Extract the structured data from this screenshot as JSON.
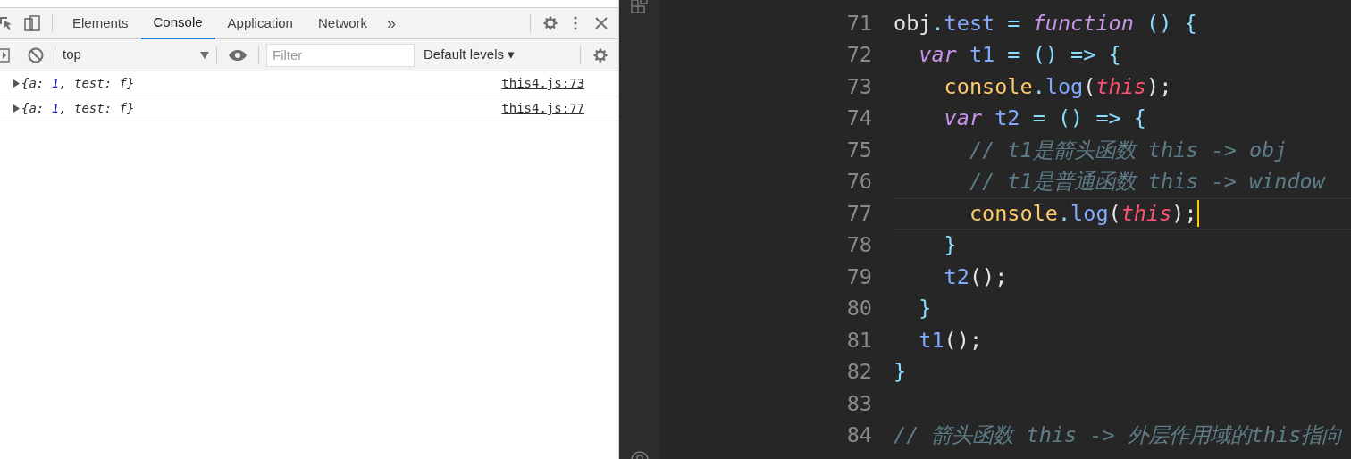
{
  "devtools": {
    "tabs": [
      {
        "label": "Elements",
        "selected": false
      },
      {
        "label": "Console",
        "selected": true
      },
      {
        "label": "Application",
        "selected": false
      },
      {
        "label": "Network",
        "selected": false
      }
    ],
    "more_tabs": "»",
    "context": "top",
    "filter": {
      "placeholder": "Filter"
    },
    "levels": "Default levels ▾",
    "messages": [
      {
        "parts": [
          {
            "text": "{a: ",
            "kind": "plain"
          },
          {
            "text": "1",
            "kind": "number"
          },
          {
            "text": ", test: ",
            "kind": "plain"
          },
          {
            "text": "f",
            "kind": "plain"
          },
          {
            "text": "}",
            "kind": "plain"
          }
        ],
        "source": "this4.js:73"
      },
      {
        "parts": [
          {
            "text": "{a: ",
            "kind": "plain"
          },
          {
            "text": "1",
            "kind": "number"
          },
          {
            "text": ", test: ",
            "kind": "plain"
          },
          {
            "text": "f",
            "kind": "plain"
          },
          {
            "text": "}",
            "kind": "plain"
          }
        ],
        "source": "this4.js:77"
      }
    ]
  },
  "editor": {
    "lines": [
      {
        "number": "71",
        "current": false,
        "tokens": [
          {
            "text": "obj",
            "kind": "plain"
          },
          {
            "text": ".",
            "kind": "op"
          },
          {
            "text": "test",
            "kind": "prop"
          },
          {
            "text": " = ",
            "kind": "op"
          },
          {
            "text": "function",
            "kind": "keyword"
          },
          {
            "text": " () {",
            "kind": "op"
          }
        ]
      },
      {
        "number": "72",
        "current": false,
        "tokens": [
          {
            "text": "  var",
            "kind": "keyword"
          },
          {
            "text": " t1",
            "kind": "prop"
          },
          {
            "text": " = () => {",
            "kind": "op"
          }
        ]
      },
      {
        "number": "73",
        "current": false,
        "tokens": [
          {
            "text": "    console",
            "kind": "func"
          },
          {
            "text": ".",
            "kind": "op"
          },
          {
            "text": "log",
            "kind": "prop"
          },
          {
            "text": "(",
            "kind": "plain"
          },
          {
            "text": "this",
            "kind": "this"
          },
          {
            "text": ");",
            "kind": "plain"
          }
        ]
      },
      {
        "number": "74",
        "current": false,
        "tokens": [
          {
            "text": "    var",
            "kind": "keyword"
          },
          {
            "text": " t2",
            "kind": "prop"
          },
          {
            "text": " = () => {",
            "kind": "op"
          }
        ]
      },
      {
        "number": "75",
        "current": false,
        "tokens": [
          {
            "text": "      // t1是箭头函数 this -> obj",
            "kind": "comment"
          }
        ]
      },
      {
        "number": "76",
        "current": false,
        "tokens": [
          {
            "text": "      // t1是普通函数 this -> window",
            "kind": "comment"
          }
        ]
      },
      {
        "number": "77",
        "current": true,
        "tokens": [
          {
            "text": "      console",
            "kind": "func"
          },
          {
            "text": ".",
            "kind": "op"
          },
          {
            "text": "log",
            "kind": "prop"
          },
          {
            "text": "(",
            "kind": "plain"
          },
          {
            "text": "this",
            "kind": "this"
          },
          {
            "text": ");",
            "kind": "plain"
          }
        ]
      },
      {
        "number": "78",
        "current": false,
        "tokens": [
          {
            "text": "    }",
            "kind": "op"
          }
        ]
      },
      {
        "number": "79",
        "current": false,
        "tokens": [
          {
            "text": "    t2",
            "kind": "prop"
          },
          {
            "text": "();",
            "kind": "plain"
          }
        ]
      },
      {
        "number": "80",
        "current": false,
        "tokens": [
          {
            "text": "  }",
            "kind": "op"
          }
        ]
      },
      {
        "number": "81",
        "current": false,
        "tokens": [
          {
            "text": "  t1",
            "kind": "prop"
          },
          {
            "text": "();",
            "kind": "plain"
          }
        ]
      },
      {
        "number": "82",
        "current": false,
        "tokens": [
          {
            "text": "}",
            "kind": "op"
          }
        ]
      },
      {
        "number": "83",
        "current": false
      },
      {
        "number": "84",
        "current": false,
        "tokens": [
          {
            "text": "// 箭头函数 this -> 外层作用域的this指向",
            "kind": "comment"
          }
        ]
      }
    ]
  }
}
